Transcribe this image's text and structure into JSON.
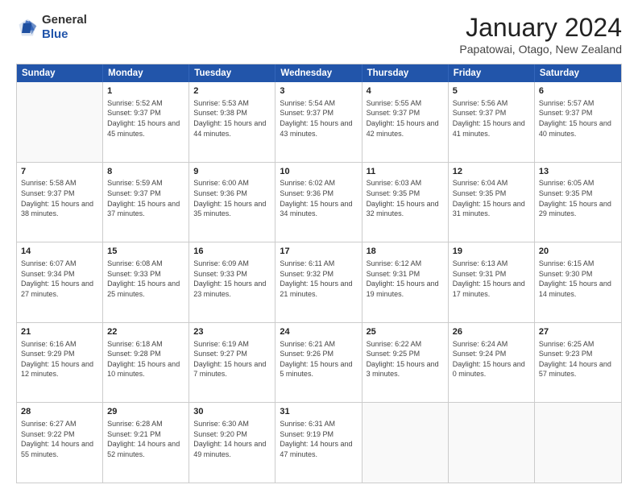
{
  "header": {
    "logo_line1": "General",
    "logo_line2": "Blue",
    "month": "January 2024",
    "location": "Papatowai, Otago, New Zealand"
  },
  "weekdays": [
    "Sunday",
    "Monday",
    "Tuesday",
    "Wednesday",
    "Thursday",
    "Friday",
    "Saturday"
  ],
  "weeks": [
    [
      {
        "day": "",
        "empty": true
      },
      {
        "day": "1",
        "sunrise": "Sunrise: 5:52 AM",
        "sunset": "Sunset: 9:37 PM",
        "daylight": "Daylight: 15 hours and 45 minutes."
      },
      {
        "day": "2",
        "sunrise": "Sunrise: 5:53 AM",
        "sunset": "Sunset: 9:38 PM",
        "daylight": "Daylight: 15 hours and 44 minutes."
      },
      {
        "day": "3",
        "sunrise": "Sunrise: 5:54 AM",
        "sunset": "Sunset: 9:37 PM",
        "daylight": "Daylight: 15 hours and 43 minutes."
      },
      {
        "day": "4",
        "sunrise": "Sunrise: 5:55 AM",
        "sunset": "Sunset: 9:37 PM",
        "daylight": "Daylight: 15 hours and 42 minutes."
      },
      {
        "day": "5",
        "sunrise": "Sunrise: 5:56 AM",
        "sunset": "Sunset: 9:37 PM",
        "daylight": "Daylight: 15 hours and 41 minutes."
      },
      {
        "day": "6",
        "sunrise": "Sunrise: 5:57 AM",
        "sunset": "Sunset: 9:37 PM",
        "daylight": "Daylight: 15 hours and 40 minutes."
      }
    ],
    [
      {
        "day": "7",
        "sunrise": "Sunrise: 5:58 AM",
        "sunset": "Sunset: 9:37 PM",
        "daylight": "Daylight: 15 hours and 38 minutes."
      },
      {
        "day": "8",
        "sunrise": "Sunrise: 5:59 AM",
        "sunset": "Sunset: 9:37 PM",
        "daylight": "Daylight: 15 hours and 37 minutes."
      },
      {
        "day": "9",
        "sunrise": "Sunrise: 6:00 AM",
        "sunset": "Sunset: 9:36 PM",
        "daylight": "Daylight: 15 hours and 35 minutes."
      },
      {
        "day": "10",
        "sunrise": "Sunrise: 6:02 AM",
        "sunset": "Sunset: 9:36 PM",
        "daylight": "Daylight: 15 hours and 34 minutes."
      },
      {
        "day": "11",
        "sunrise": "Sunrise: 6:03 AM",
        "sunset": "Sunset: 9:35 PM",
        "daylight": "Daylight: 15 hours and 32 minutes."
      },
      {
        "day": "12",
        "sunrise": "Sunrise: 6:04 AM",
        "sunset": "Sunset: 9:35 PM",
        "daylight": "Daylight: 15 hours and 31 minutes."
      },
      {
        "day": "13",
        "sunrise": "Sunrise: 6:05 AM",
        "sunset": "Sunset: 9:35 PM",
        "daylight": "Daylight: 15 hours and 29 minutes."
      }
    ],
    [
      {
        "day": "14",
        "sunrise": "Sunrise: 6:07 AM",
        "sunset": "Sunset: 9:34 PM",
        "daylight": "Daylight: 15 hours and 27 minutes."
      },
      {
        "day": "15",
        "sunrise": "Sunrise: 6:08 AM",
        "sunset": "Sunset: 9:33 PM",
        "daylight": "Daylight: 15 hours and 25 minutes."
      },
      {
        "day": "16",
        "sunrise": "Sunrise: 6:09 AM",
        "sunset": "Sunset: 9:33 PM",
        "daylight": "Daylight: 15 hours and 23 minutes."
      },
      {
        "day": "17",
        "sunrise": "Sunrise: 6:11 AM",
        "sunset": "Sunset: 9:32 PM",
        "daylight": "Daylight: 15 hours and 21 minutes."
      },
      {
        "day": "18",
        "sunrise": "Sunrise: 6:12 AM",
        "sunset": "Sunset: 9:31 PM",
        "daylight": "Daylight: 15 hours and 19 minutes."
      },
      {
        "day": "19",
        "sunrise": "Sunrise: 6:13 AM",
        "sunset": "Sunset: 9:31 PM",
        "daylight": "Daylight: 15 hours and 17 minutes."
      },
      {
        "day": "20",
        "sunrise": "Sunrise: 6:15 AM",
        "sunset": "Sunset: 9:30 PM",
        "daylight": "Daylight: 15 hours and 14 minutes."
      }
    ],
    [
      {
        "day": "21",
        "sunrise": "Sunrise: 6:16 AM",
        "sunset": "Sunset: 9:29 PM",
        "daylight": "Daylight: 15 hours and 12 minutes."
      },
      {
        "day": "22",
        "sunrise": "Sunrise: 6:18 AM",
        "sunset": "Sunset: 9:28 PM",
        "daylight": "Daylight: 15 hours and 10 minutes."
      },
      {
        "day": "23",
        "sunrise": "Sunrise: 6:19 AM",
        "sunset": "Sunset: 9:27 PM",
        "daylight": "Daylight: 15 hours and 7 minutes."
      },
      {
        "day": "24",
        "sunrise": "Sunrise: 6:21 AM",
        "sunset": "Sunset: 9:26 PM",
        "daylight": "Daylight: 15 hours and 5 minutes."
      },
      {
        "day": "25",
        "sunrise": "Sunrise: 6:22 AM",
        "sunset": "Sunset: 9:25 PM",
        "daylight": "Daylight: 15 hours and 3 minutes."
      },
      {
        "day": "26",
        "sunrise": "Sunrise: 6:24 AM",
        "sunset": "Sunset: 9:24 PM",
        "daylight": "Daylight: 15 hours and 0 minutes."
      },
      {
        "day": "27",
        "sunrise": "Sunrise: 6:25 AM",
        "sunset": "Sunset: 9:23 PM",
        "daylight": "Daylight: 14 hours and 57 minutes."
      }
    ],
    [
      {
        "day": "28",
        "sunrise": "Sunrise: 6:27 AM",
        "sunset": "Sunset: 9:22 PM",
        "daylight": "Daylight: 14 hours and 55 minutes."
      },
      {
        "day": "29",
        "sunrise": "Sunrise: 6:28 AM",
        "sunset": "Sunset: 9:21 PM",
        "daylight": "Daylight: 14 hours and 52 minutes."
      },
      {
        "day": "30",
        "sunrise": "Sunrise: 6:30 AM",
        "sunset": "Sunset: 9:20 PM",
        "daylight": "Daylight: 14 hours and 49 minutes."
      },
      {
        "day": "31",
        "sunrise": "Sunrise: 6:31 AM",
        "sunset": "Sunset: 9:19 PM",
        "daylight": "Daylight: 14 hours and 47 minutes."
      },
      {
        "day": "",
        "empty": true
      },
      {
        "day": "",
        "empty": true
      },
      {
        "day": "",
        "empty": true
      }
    ]
  ]
}
